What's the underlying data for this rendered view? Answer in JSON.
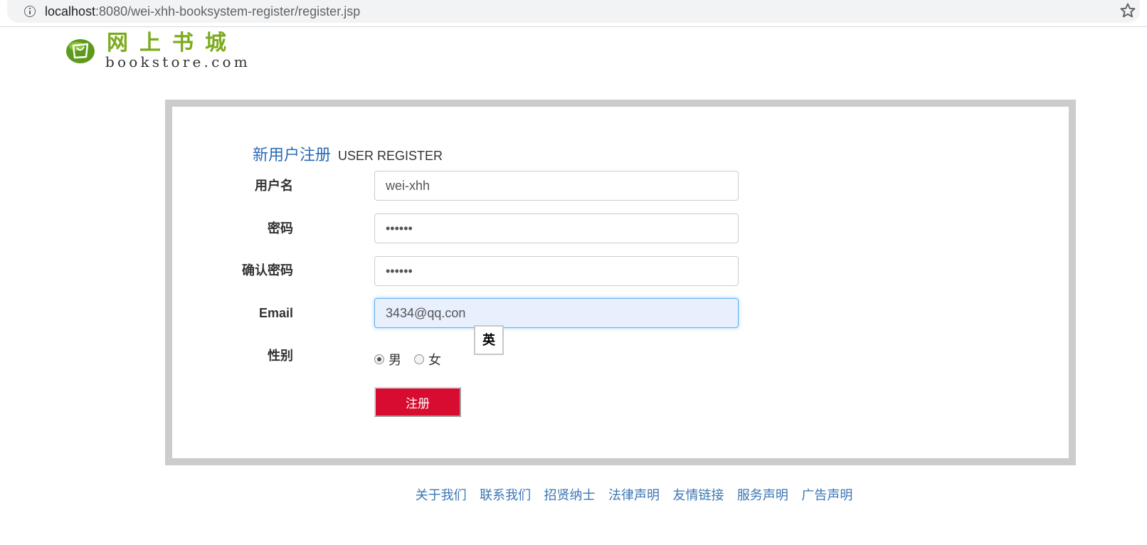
{
  "browser": {
    "url_host": "localhost",
    "url_path": ":8080/wei-xhh-booksystem-register/register.jsp"
  },
  "logo": {
    "cn": "网上书城",
    "en": "bookstore.com"
  },
  "form": {
    "title_cn": "新用户注册",
    "title_en": "USER REGISTER",
    "username_label": "用户名",
    "username_value": "wei-xhh",
    "password_label": "密码",
    "password_value": "123456",
    "confirm_label": "确认密码",
    "confirm_value": "123456",
    "email_label": "Email",
    "email_value": "3434@qq.con",
    "gender_label": "性别",
    "gender_options": [
      "男",
      "女"
    ],
    "gender_selected": "男",
    "submit_label": "注册",
    "ime_indicator": "英"
  },
  "footer": {
    "links": [
      "关于我们",
      "联系我们",
      "招贤纳士",
      "法律声明",
      "友情链接",
      "服务声明",
      "广告声明"
    ]
  },
  "colors": {
    "title_blue": "#2a6bb6",
    "logo_green": "#7cab1d",
    "button_red": "#d70c30",
    "link_blue": "#3a76b5",
    "panel_border": "#cccccc"
  }
}
